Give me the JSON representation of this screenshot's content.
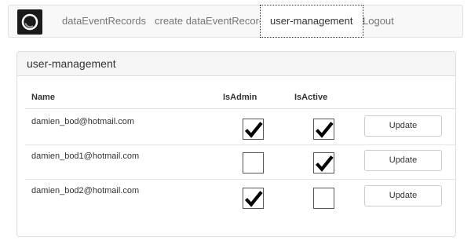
{
  "nav": {
    "items": [
      {
        "label": "dataEventRecords"
      },
      {
        "label": "create dataEventRecord"
      },
      {
        "label": "user-management",
        "active": true
      },
      {
        "label": "Logout"
      }
    ]
  },
  "panel": {
    "heading": "user-management"
  },
  "table": {
    "columns": [
      "Name",
      "IsAdmin",
      "IsActive"
    ],
    "rows": [
      {
        "name": "damien_bod@hotmail.com",
        "is_admin": true,
        "is_active": true,
        "action": "Update"
      },
      {
        "name": "damien_bod1@hotmail.com",
        "is_admin": false,
        "is_active": true,
        "action": "Update"
      },
      {
        "name": "damien_bod2@hotmail.com",
        "is_admin": true,
        "is_active": false,
        "action": "Update"
      }
    ]
  },
  "colors": {
    "navbar_bg": "#f8f8f8",
    "panel_heading_bg": "#f5f5f5",
    "text": "#333333",
    "muted_text": "#777777"
  }
}
